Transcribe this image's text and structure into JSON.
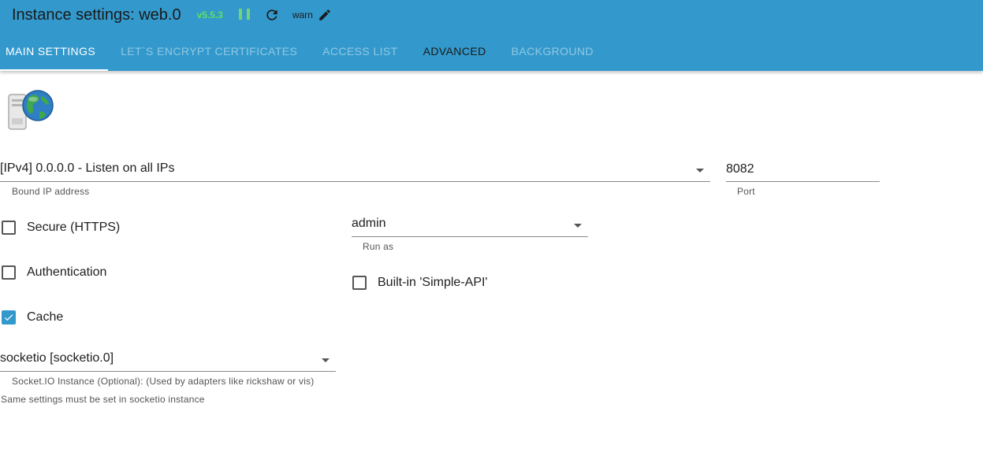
{
  "header": {
    "title": "Instance settings: web.0",
    "version": "v5.5.3",
    "loglevel": "warn"
  },
  "tabs": [
    {
      "label": "MAIN SETTINGS",
      "state": "active"
    },
    {
      "label": "LET`S ENCRYPT CERTIFICATES",
      "state": "disabled"
    },
    {
      "label": "ACCESS LIST",
      "state": "disabled"
    },
    {
      "label": "ADVANCED",
      "state": "enabled"
    },
    {
      "label": "BACKGROUND",
      "state": "disabled"
    }
  ],
  "form": {
    "bind": {
      "value": "[IPv4] 0.0.0.0 - Listen on all IPs",
      "label": "Bound IP address"
    },
    "port": {
      "value": "8082",
      "label": "Port"
    },
    "secure": {
      "label": "Secure (HTTPS)",
      "checked": false
    },
    "run_as": {
      "value": "admin",
      "label": "Run as"
    },
    "auth": {
      "label": "Authentication",
      "checked": false
    },
    "simple_api": {
      "label": "Built-in 'Simple-API'",
      "checked": false
    },
    "cache": {
      "label": "Cache",
      "checked": true
    },
    "socketio": {
      "value": "socketio [socketio.0]",
      "label": "Socket.IO Instance (Optional): (Used by adapters like rickshaw or vis)",
      "note": "Same settings must be set in socketio instance"
    }
  },
  "colors": {
    "header_bg": "#3399cc",
    "version": "#5fe05f",
    "accent": "#3399cc"
  }
}
